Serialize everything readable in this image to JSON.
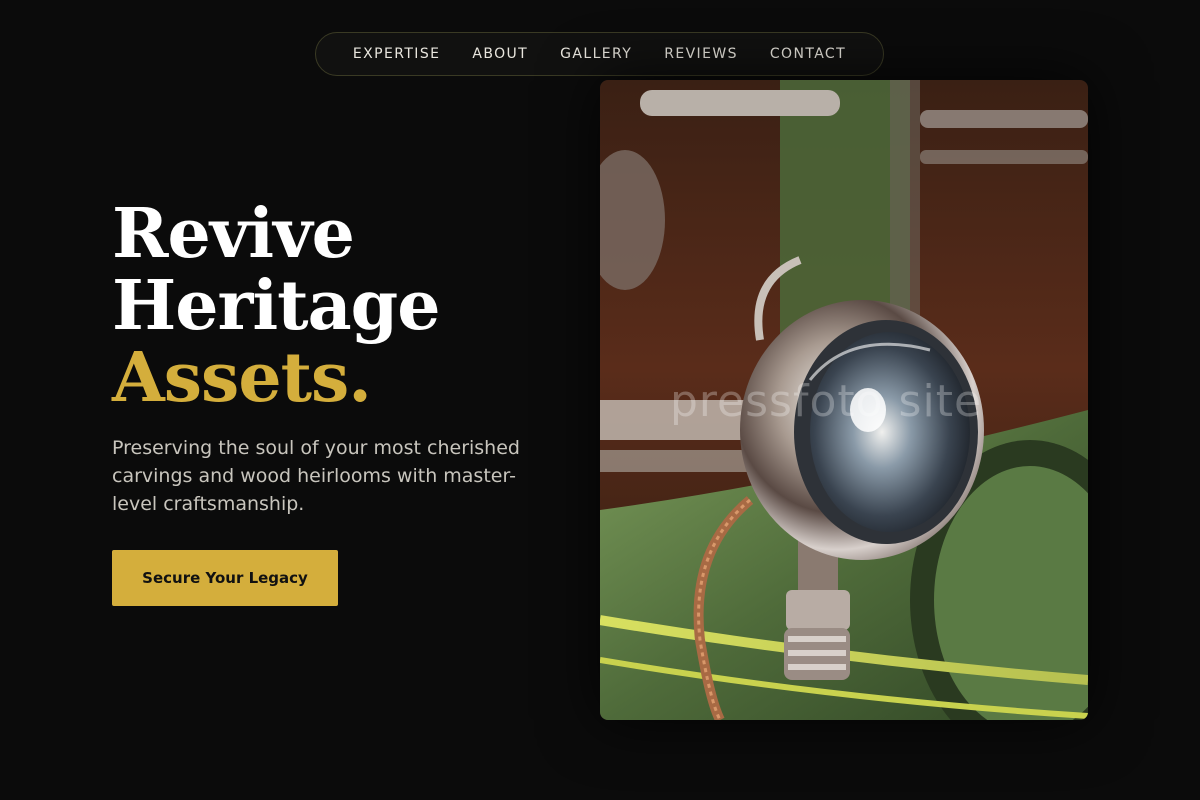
{
  "nav": {
    "items": [
      {
        "label": "EXPERTISE"
      },
      {
        "label": "ABOUT"
      },
      {
        "label": "GALLERY"
      },
      {
        "label": "REVIEWS"
      },
      {
        "label": "CONTACT"
      }
    ]
  },
  "hero": {
    "headline_line1": "Revive",
    "headline_line2": "Heritage",
    "headline_accent": "Assets.",
    "subtitle": "Preserving the soul of your most cherished carvings and wood heirlooms with master-level craftsmanship.",
    "cta_label": "Secure Your Legacy",
    "image_watermark": "pressfoto site"
  },
  "colors": {
    "background": "#0b0b0b",
    "accent": "#d4ae3c",
    "text": "#ffffff",
    "muted_text": "#c8c5bd"
  }
}
